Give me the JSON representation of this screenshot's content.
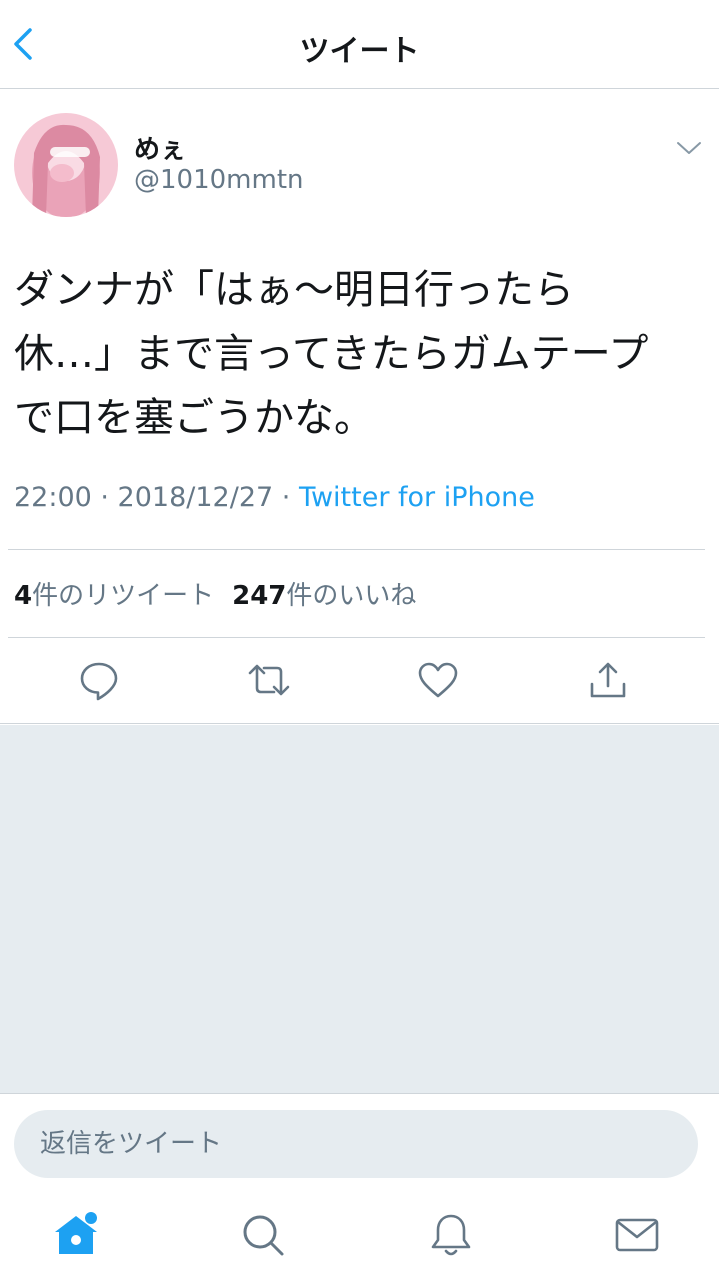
{
  "nav": {
    "title": "ツイート",
    "back_icon": "chevron-left-icon"
  },
  "author": {
    "name": "めぇ",
    "handle": "@1010mmtn"
  },
  "tweet": {
    "lines": [
      "ダンナが「はぁ〜明日行ったら",
      "休…」まで言ってきたらガムテープ",
      "で口を塞ごうかな。"
    ],
    "timestamp": "22:00 · 2018/12/27 · ",
    "source": "Twitter for iPhone"
  },
  "stats": {
    "retweet_count": "4",
    "retweet_label": "件のリツイート",
    "like_count": "247",
    "like_label": "件のいいね"
  },
  "actions": [
    "reply-icon",
    "retweet-icon",
    "like-icon",
    "share-icon"
  ],
  "reply": {
    "placeholder": "返信をツイート"
  },
  "tabs": [
    "home-icon",
    "search-icon",
    "notifications-icon",
    "messages-icon"
  ],
  "colors": {
    "accent": "#1da1f2",
    "text": "#14171a",
    "secondary": "#657786",
    "background_gray": "#e6ecf0",
    "divider": "#cfd5da"
  }
}
